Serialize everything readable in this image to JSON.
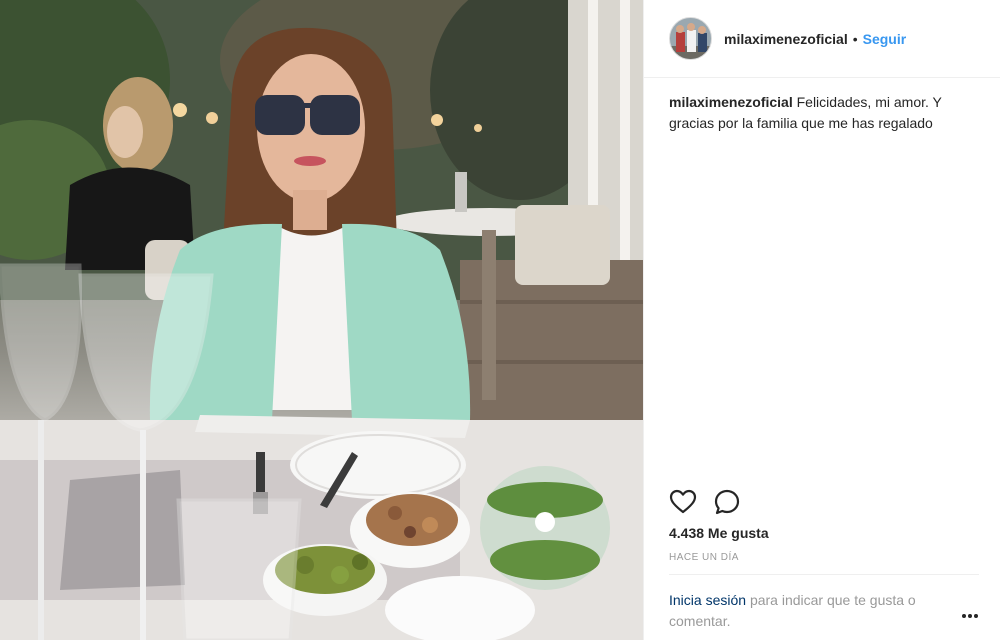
{
  "post": {
    "username": "milaximenezoficial",
    "separator": "•",
    "follow_label": "Seguir",
    "caption": {
      "username": "milaximenezoficial",
      "text": "Felicidades, mi amor. Y gracias por la familia que me has regalado"
    },
    "likes": "4.438 Me gusta",
    "timestamp": "HACE UN DÍA",
    "login_prompt": {
      "link": "Inicia sesión",
      "text": "para indicar que te gusta o comentar."
    }
  },
  "icons": {
    "like": "heart-icon",
    "comment": "comment-icon",
    "more": "more-options-icon"
  },
  "colors": {
    "follow_blue": "#3897f0",
    "link_dark_blue": "#003569",
    "muted_gray": "#999999",
    "text": "#262626",
    "divider": "#efefef"
  }
}
